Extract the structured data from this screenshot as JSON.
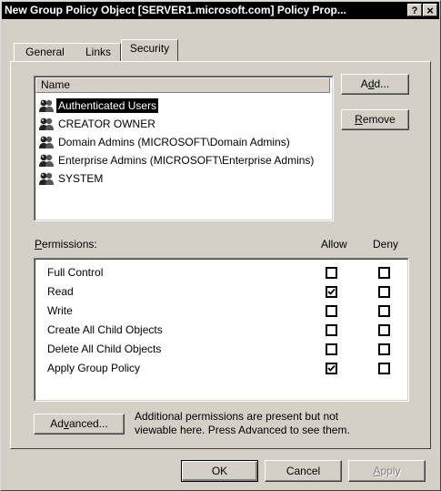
{
  "window": {
    "title": "New Group Policy Object [SERVER1.microsoft.com] Policy Prop...",
    "help_glyph": "?",
    "close_glyph": "×"
  },
  "tabs": [
    {
      "label": "General",
      "active": false
    },
    {
      "label": "Links",
      "active": false
    },
    {
      "label": "Security",
      "active": true
    }
  ],
  "users_list": {
    "column_header": "Name",
    "items": [
      {
        "label": "Authenticated Users",
        "selected": true
      },
      {
        "label": "CREATOR OWNER",
        "selected": false
      },
      {
        "label": "Domain Admins (MICROSOFT\\Domain Admins)",
        "selected": false
      },
      {
        "label": "Enterprise Admins (MICROSOFT\\Enterprise Admins)",
        "selected": false
      },
      {
        "label": "SYSTEM",
        "selected": false
      }
    ]
  },
  "buttons": {
    "add": {
      "pre": "A",
      "key": "d",
      "post": "d..."
    },
    "remove": {
      "pre": "",
      "key": "R",
      "post": "emove"
    },
    "advanced": {
      "pre": "Ad",
      "key": "v",
      "post": "anced..."
    },
    "ok": "OK",
    "cancel": "Cancel",
    "apply": {
      "pre": "",
      "key": "A",
      "post": "pply"
    }
  },
  "permissions": {
    "label_key": "P",
    "label_rest": "ermissions:",
    "allow_header": "Allow",
    "deny_header": "Deny",
    "rows": [
      {
        "name": "Full Control",
        "allow": false,
        "deny": false
      },
      {
        "name": "Read",
        "allow": true,
        "deny": false
      },
      {
        "name": "Write",
        "allow": false,
        "deny": false
      },
      {
        "name": "Create All Child Objects",
        "allow": false,
        "deny": false
      },
      {
        "name": "Delete All Child Objects",
        "allow": false,
        "deny": false
      },
      {
        "name": "Apply Group Policy",
        "allow": true,
        "deny": false
      }
    ]
  },
  "advanced_note": {
    "line1": "Additional permissions are present but not",
    "line2": "viewable here. Press Advanced to see them."
  }
}
